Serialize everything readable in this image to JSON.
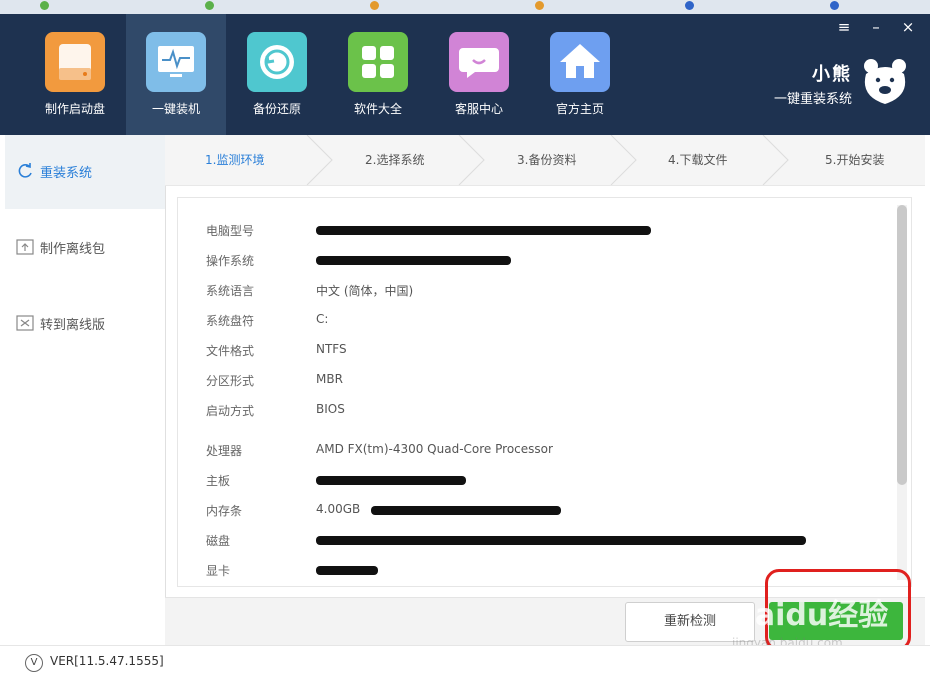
{
  "window_controls": {
    "menu": "≡",
    "minimize": "–",
    "close": "×"
  },
  "nav": [
    {
      "label": "制作启动盘",
      "icon": "usb-drive-icon",
      "color": "#f29a3e",
      "active": false
    },
    {
      "label": "一键装机",
      "icon": "monitor-pulse-icon",
      "color": "#7fbde8",
      "active": true
    },
    {
      "label": "备份还原",
      "icon": "restore-icon",
      "color": "#4fc7cf",
      "active": false
    },
    {
      "label": "软件大全",
      "icon": "apps-grid-icon",
      "color": "#6bc24a",
      "active": false
    },
    {
      "label": "客服中心",
      "icon": "chat-bubble-icon",
      "color": "#d184d6",
      "active": false
    },
    {
      "label": "官方主页",
      "icon": "home-icon",
      "color": "#6e9ff0",
      "active": false
    }
  ],
  "brand": {
    "title": "小熊",
    "subtitle": "一键重装系统",
    "icon": "bear-icon"
  },
  "sidebar": [
    {
      "label": "重装系统",
      "icon": "refresh-icon",
      "active": true
    },
    {
      "label": "制作离线包",
      "icon": "upload-box-icon",
      "active": false
    },
    {
      "label": "转到离线版",
      "icon": "switch-box-icon",
      "active": false
    }
  ],
  "steps": [
    {
      "label": "1.监测环境",
      "active": true
    },
    {
      "label": "2.选择系统",
      "active": false
    },
    {
      "label": "3.备份资料",
      "active": false
    },
    {
      "label": "4.下载文件",
      "active": false
    },
    {
      "label": "5.开始安装",
      "active": false
    }
  ],
  "info": [
    {
      "key": "电脑型号",
      "value": "",
      "redacted": true
    },
    {
      "key": "操作系统",
      "value": "",
      "redacted": true
    },
    {
      "key": "系统语言",
      "value": "中文 (简体，中国)",
      "redacted": false
    },
    {
      "key": "系统盘符",
      "value": "C:",
      "redacted": false
    },
    {
      "key": "文件格式",
      "value": "NTFS",
      "redacted": false
    },
    {
      "key": "分区形式",
      "value": "MBR",
      "redacted": false
    },
    {
      "key": "启动方式",
      "value": "BIOS",
      "redacted": false
    },
    {
      "key": "处理器",
      "value": "AMD FX(tm)-4300 Quad-Core Processor",
      "redacted": false
    },
    {
      "key": "主板",
      "value": "",
      "redacted": true
    },
    {
      "key": "内存条",
      "value": "4.00GB",
      "redacted": true
    },
    {
      "key": "磁盘",
      "value": "",
      "redacted": true
    },
    {
      "key": "显卡",
      "value": "",
      "redacted": true
    }
  ],
  "buttons": {
    "recheck": "重新检测",
    "next": ""
  },
  "status": {
    "version": "VER[11.5.47.1555]",
    "icon": "version-v-icon"
  },
  "watermark": {
    "main": "Baidu经验",
    "sub": "jingyan.baidu.com"
  },
  "highlight_color": "#e0201e",
  "accent_color": "#2a7fd8",
  "next_button_color": "#3db63d"
}
